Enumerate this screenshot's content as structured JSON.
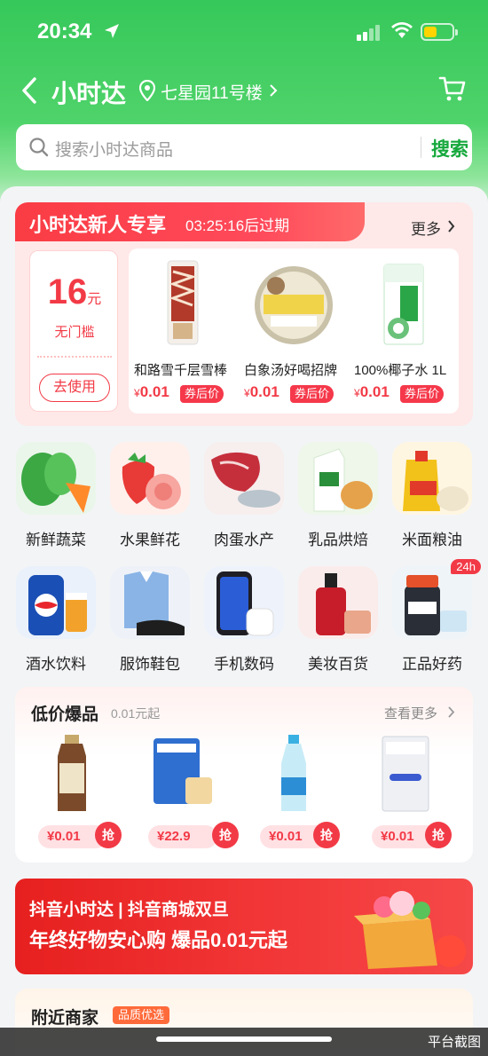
{
  "status": {
    "time": "20:34"
  },
  "nav": {
    "title": "小时达",
    "address": "七星园11号楼"
  },
  "search": {
    "placeholder": "搜索小时达商品",
    "button": "搜索"
  },
  "promo": {
    "title": "小时达新人专享",
    "timer": "03:25:16后过期",
    "more": "更多",
    "coupon": {
      "amount": "16",
      "unit": "元",
      "condition": "无门槛",
      "use_button": "去使用"
    },
    "products": [
      {
        "name": "和路雪千层雪棒",
        "price": "0.01",
        "currency": "¥",
        "tag": "券后价"
      },
      {
        "name": "白象汤好喝招牌",
        "price": "0.01",
        "currency": "¥",
        "tag": "券后价"
      },
      {
        "name": "100%椰子水 1L",
        "price": "0.01",
        "currency": "¥",
        "tag": "券后价"
      }
    ]
  },
  "categories": [
    {
      "label": "新鲜蔬菜"
    },
    {
      "label": "水果鲜花"
    },
    {
      "label": "肉蛋水产"
    },
    {
      "label": "乳品烘焙"
    },
    {
      "label": "米面粮油"
    },
    {
      "label": "酒水饮料"
    },
    {
      "label": "服饰鞋包"
    },
    {
      "label": "手机数码"
    },
    {
      "label": "美妆百货"
    },
    {
      "label": "正品好药",
      "badge": "24h"
    }
  ],
  "deals": {
    "title": "低价爆品",
    "subtitle": "0.01元起",
    "more": "查看更多",
    "items": [
      {
        "price": "¥0.01",
        "grab": "抢"
      },
      {
        "price": "¥22.9",
        "grab": "抢"
      },
      {
        "price": "¥0.01",
        "grab": "抢"
      },
      {
        "price": "¥0.01",
        "grab": "抢"
      }
    ]
  },
  "banner": {
    "brand": "抖音小时达 | 抖音商城双旦",
    "headline": "年终好物安心购 爆品0.01元起"
  },
  "nearby": {
    "title": "附近商家",
    "tag": "品质优选"
  },
  "watermark": "平台截图",
  "colors": {
    "brand_green": "#36c85a",
    "accent_red": "#f23a46",
    "search_green": "#15a83c"
  }
}
